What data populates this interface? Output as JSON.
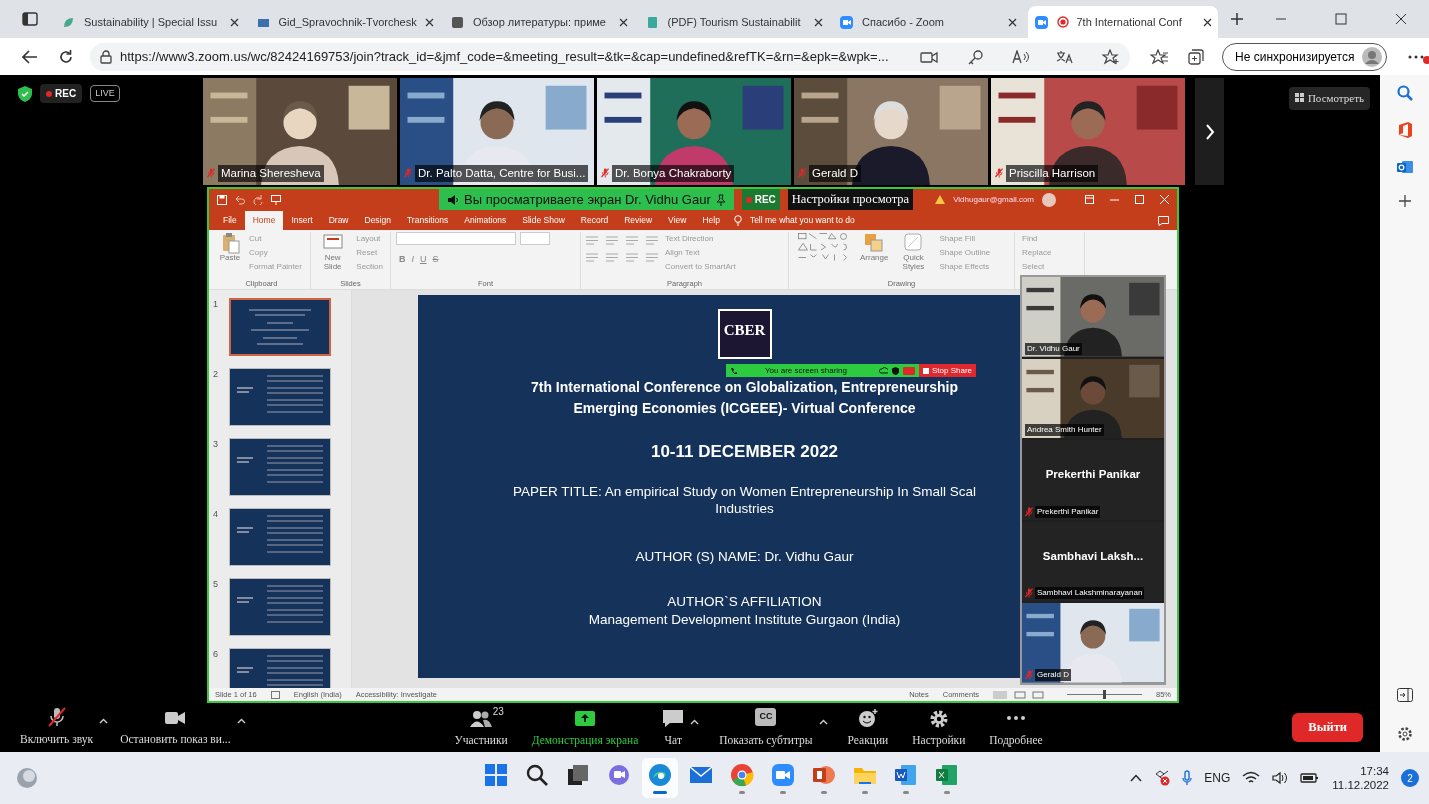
{
  "browser": {
    "tabs": [
      {
        "title": "Sustainability | Special Issu",
        "kind": "leaf",
        "selected": false
      },
      {
        "title": "Gid_Spravochnik-Tvorchesk",
        "kind": "book",
        "selected": false
      },
      {
        "title": "Обзор литературы: приме",
        "kind": "letter",
        "selected": false
      },
      {
        "title": "(PDF) Tourism Sustainabilit",
        "kind": "paper",
        "selected": false
      },
      {
        "title": "Спасибо - Zoom",
        "kind": "camera",
        "selected": false
      },
      {
        "title": "7th International Conf",
        "kind": "camera",
        "selected": true
      }
    ],
    "url": "https://www3.zoom.us/wc/82424169753/join?track_id=&jmf_code=&meeting_result=&tk=&cap=undefined&refTK=&rn=&epk=&wpk=...",
    "sync_button": "Не синхронизируется"
  },
  "meeting": {
    "rec": "REC",
    "live": "LIVE",
    "gallery": [
      {
        "name": "Marina Sheresheva",
        "muted": true
      },
      {
        "name": "Dr. Palto Datta, Centre for Busi...",
        "muted": true
      },
      {
        "name": "Dr. Bonya Chakraborty",
        "muted": true
      },
      {
        "name": "Gerald D",
        "muted": true
      },
      {
        "name": "Priscilla Harrison",
        "muted": true
      }
    ],
    "view_button": "Посмотреть"
  },
  "share": {
    "banner": "Вы просматриваете экран Dr. Vidhu Gaur",
    "rec": "REC",
    "view_settings": "Настройки просмотра",
    "powerpoint": {
      "account": "Vidhugaur@gmail.com",
      "ribbon_tabs": [
        {
          "label": "File",
          "selected": false
        },
        {
          "label": "Home",
          "selected": true
        },
        {
          "label": "Insert",
          "selected": false
        },
        {
          "label": "Draw",
          "selected": false
        },
        {
          "label": "Design",
          "selected": false
        },
        {
          "label": "Transitions",
          "selected": false
        },
        {
          "label": "Animations",
          "selected": false
        },
        {
          "label": "Slide Show",
          "selected": false
        },
        {
          "label": "Record",
          "selected": false
        },
        {
          "label": "Review",
          "selected": false
        },
        {
          "label": "View",
          "selected": false
        },
        {
          "label": "Help",
          "selected": false
        }
      ],
      "tell_me": "Tell me what you want to do",
      "ribbon_groups": [
        {
          "kind": "clipboard",
          "label": "Clipboard",
          "big": "Paste",
          "commands": [
            "Cut",
            "Copy",
            "Format Painter"
          ]
        },
        {
          "kind": "slides",
          "label": "Slides",
          "big": "New Slide",
          "commands": [
            "Layout",
            "Reset",
            "Section"
          ]
        },
        {
          "kind": "font",
          "label": "Font",
          "buttons": [
            "B",
            "I",
            "U",
            "S"
          ]
        },
        {
          "kind": "paragraph",
          "label": "Paragraph",
          "commands": [
            "Text Direction",
            "Align Text",
            "Convert to SmartArt"
          ]
        },
        {
          "kind": "drawing",
          "label": "Drawing",
          "big": "Arrange",
          "big2": "Quick Styles",
          "commands": [
            "Shape Fill",
            "Shape Outline",
            "Shape Effects"
          ]
        },
        {
          "kind": "editing",
          "commands": [
            "Find",
            "Replace",
            "Select"
          ]
        }
      ],
      "thumbnails": [
        {
          "number": "1",
          "selected": true
        },
        {
          "number": "2",
          "selected": false
        },
        {
          "number": "3",
          "selected": false
        },
        {
          "number": "4",
          "selected": false
        },
        {
          "number": "5",
          "selected": false
        },
        {
          "number": "6",
          "selected": false
        }
      ],
      "slide": {
        "logo": "CBER",
        "title_lines": [
          "7th International Conference on Globalization, Entrepreneurship",
          "Emerging Economies (ICGEEE)- Virtual Conference"
        ],
        "date": "10-11 DECEMBER 2022",
        "paper_lines": [
          "PAPER TITLE: An empirical Study on Women Entrepreneurship In Small Scal",
          "Industries"
        ],
        "author": "AUTHOR (S) NAME: Dr. Vidhu Gaur",
        "affiliation_lines": [
          "AUTHOR`S AFFILIATION",
          "Management Development Institute Gurgaon (India)"
        ]
      },
      "sharing_bar": {
        "text": "You are screen sharing",
        "stop": "Stop Share"
      },
      "status_bar": {
        "slide": "Slide 1 of 16",
        "language": "English (India)",
        "accessibility": "Accessibility: Investigate",
        "notes": "Notes",
        "comments": "Comments",
        "zoom": {
          "level": 0.5,
          "reading": "85%"
        }
      }
    },
    "participants": [
      {
        "kind": "video",
        "name": "Dr. Vidhu Gaur",
        "muted": false
      },
      {
        "kind": "video",
        "name": "Andrea Smith Hunter",
        "muted": false
      },
      {
        "kind": "name",
        "title": "Prekerthi Panikar",
        "name": "Prekerthi Panikar",
        "muted": true
      },
      {
        "kind": "name",
        "title": "Sambhavi  Laksh...",
        "name": "Sambhavi Lakshminarayanan",
        "muted": true
      },
      {
        "kind": "video",
        "name": "Gerald D",
        "muted": true
      }
    ]
  },
  "toolbar": {
    "items": [
      {
        "kind": "mic",
        "label": "Включить звук",
        "menu": true
      },
      {
        "kind": "video",
        "label": "Остановить показ ви...",
        "menu": true
      },
      {
        "kind": "participants",
        "label": "Участники",
        "count": "23",
        "menu": false
      },
      {
        "kind": "share",
        "label": "Демонстрация экрана",
        "menu": false
      },
      {
        "kind": "chat",
        "label": "Чат",
        "menu": true
      },
      {
        "kind": "cc",
        "label": "Показать субтитры",
        "icon_text": "CC",
        "menu": true
      },
      {
        "kind": "reactions",
        "label": "Реакции",
        "menu": false
      },
      {
        "kind": "settings",
        "label": "Настройки",
        "menu": false
      },
      {
        "kind": "more",
        "label": "Подробнее",
        "menu": false
      }
    ],
    "leave": "Выйти"
  },
  "taskbar": {
    "apps": [
      {
        "kind": "start",
        "selected": false,
        "running": false
      },
      {
        "kind": "search",
        "selected": false,
        "running": false
      },
      {
        "kind": "taskview",
        "selected": false,
        "running": false
      },
      {
        "kind": "chat",
        "selected": false,
        "running": false
      },
      {
        "kind": "edge",
        "selected": true,
        "running": true
      },
      {
        "kind": "mail",
        "selected": false,
        "running": false
      },
      {
        "kind": "chrome",
        "selected": false,
        "running": true
      },
      {
        "kind": "zoom",
        "selected": false,
        "running": true
      },
      {
        "kind": "powerpoint",
        "selected": false,
        "running": true
      },
      {
        "kind": "explorer",
        "selected": false,
        "running": true
      },
      {
        "kind": "word",
        "selected": false,
        "running": true
      },
      {
        "kind": "excel",
        "selected": false,
        "running": true
      }
    ],
    "language": "ENG",
    "time": "17:34",
    "date": "11.12.2022",
    "notifications": "2"
  }
}
